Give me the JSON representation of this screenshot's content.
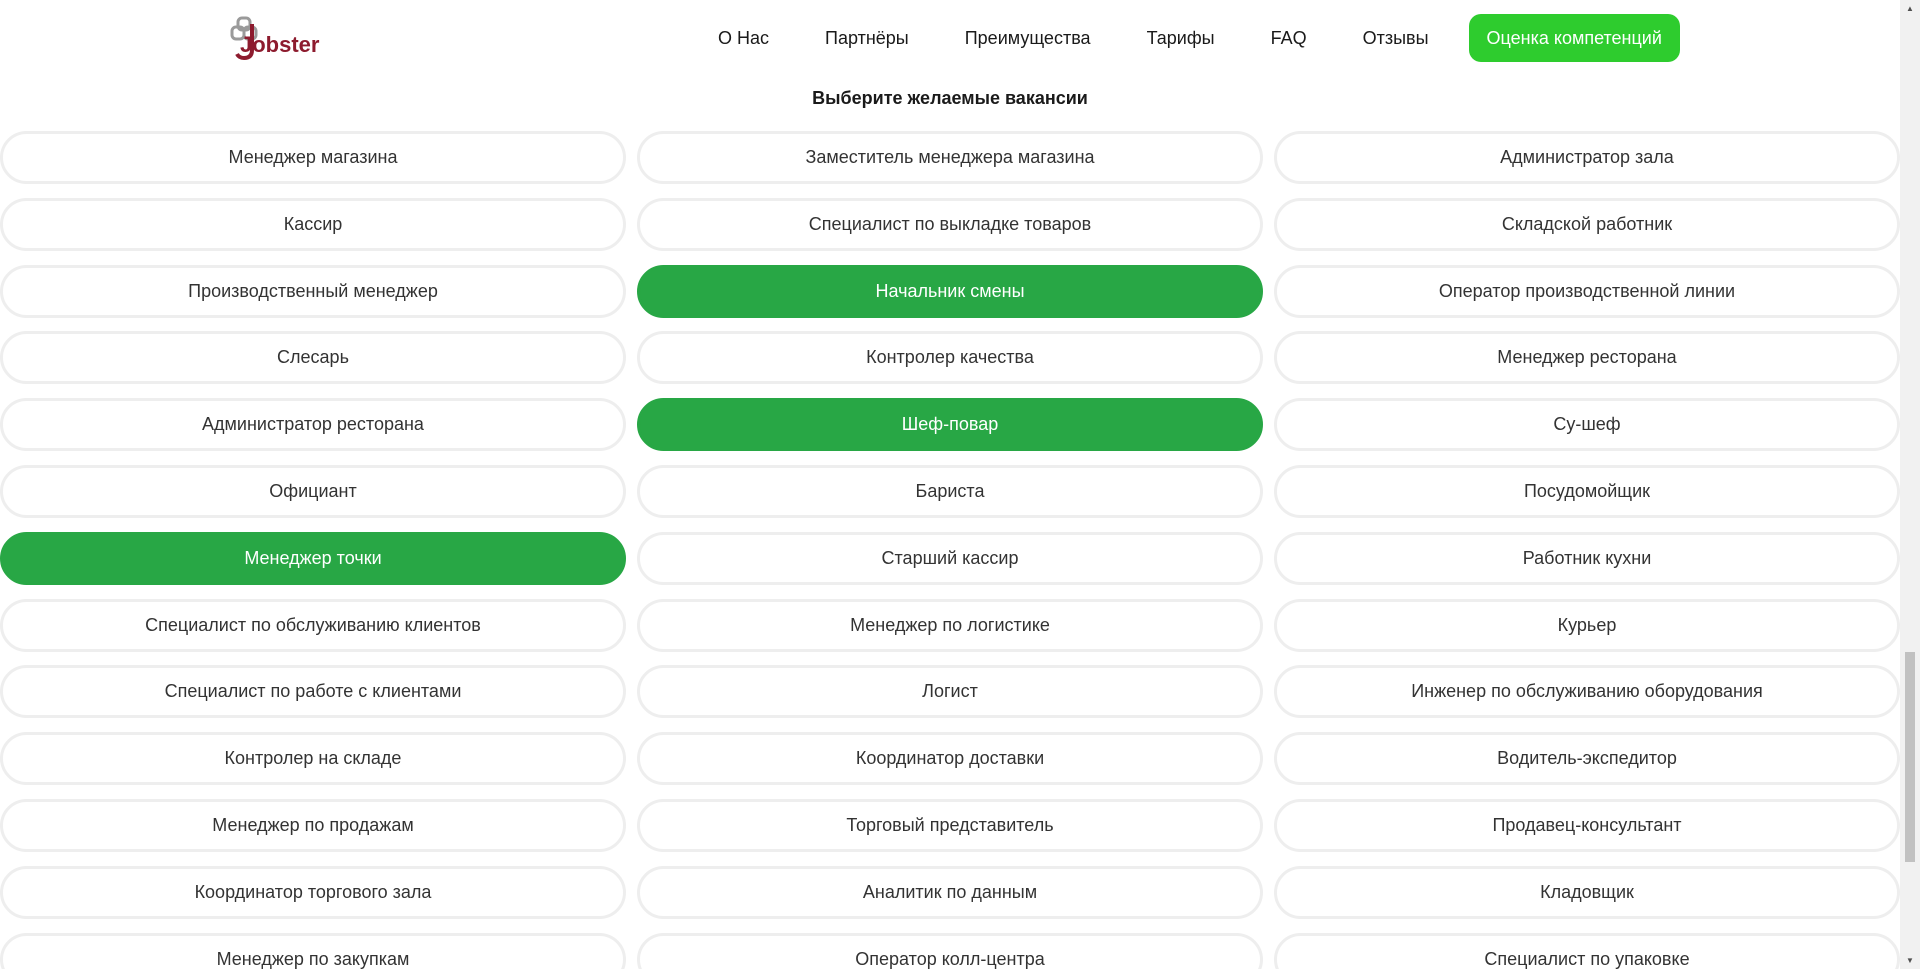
{
  "header": {
    "logo_text": "Jobster",
    "nav": [
      {
        "label": "О Нас"
      },
      {
        "label": "Партнёры"
      },
      {
        "label": "Преимущества"
      },
      {
        "label": "Тарифы"
      },
      {
        "label": "FAQ"
      },
      {
        "label": "Отзывы"
      }
    ],
    "cta_label": "Оценка компетенций"
  },
  "section": {
    "title": "Выберите желаемые вакансии"
  },
  "vacancies": [
    {
      "label": "Менеджер магазина",
      "selected": false
    },
    {
      "label": "Заместитель менеджера магазина",
      "selected": false
    },
    {
      "label": "Администратор зала",
      "selected": false
    },
    {
      "label": "Кассир",
      "selected": false
    },
    {
      "label": "Специалист по выкладке товаров",
      "selected": false
    },
    {
      "label": "Складской работник",
      "selected": false
    },
    {
      "label": "Производственный менеджер",
      "selected": false
    },
    {
      "label": "Начальник смены",
      "selected": true
    },
    {
      "label": "Оператор производственной линии",
      "selected": false
    },
    {
      "label": "Слесарь",
      "selected": false
    },
    {
      "label": "Контролер качества",
      "selected": false
    },
    {
      "label": "Менеджер ресторана",
      "selected": false
    },
    {
      "label": "Администратор ресторана",
      "selected": false
    },
    {
      "label": "Шеф-повар",
      "selected": true
    },
    {
      "label": "Су-шеф",
      "selected": false
    },
    {
      "label": "Официант",
      "selected": false
    },
    {
      "label": "Бариста",
      "selected": false
    },
    {
      "label": "Посудомойщик",
      "selected": false
    },
    {
      "label": "Менеджер точки",
      "selected": true
    },
    {
      "label": "Старший кассир",
      "selected": false
    },
    {
      "label": "Работник кухни",
      "selected": false
    },
    {
      "label": "Специалист по обслуживанию клиентов",
      "selected": false
    },
    {
      "label": "Менеджер по логистике",
      "selected": false
    },
    {
      "label": "Курьер",
      "selected": false
    },
    {
      "label": "Специалист по работе с клиентами",
      "selected": false
    },
    {
      "label": "Логист",
      "selected": false
    },
    {
      "label": "Инженер по обслуживанию оборудования",
      "selected": false
    },
    {
      "label": "Контролер на складе",
      "selected": false
    },
    {
      "label": "Координатор доставки",
      "selected": false
    },
    {
      "label": "Водитель-экспедитор",
      "selected": false
    },
    {
      "label": "Менеджер по продажам",
      "selected": false
    },
    {
      "label": "Торговый представитель",
      "selected": false
    },
    {
      "label": "Продавец-консультант",
      "selected": false
    },
    {
      "label": "Координатор торгового зала",
      "selected": false
    },
    {
      "label": "Аналитик по данным",
      "selected": false
    },
    {
      "label": "Кладовщик",
      "selected": false
    },
    {
      "label": "Менеджер по закупкам",
      "selected": false
    },
    {
      "label": "Оператор колл-центра",
      "selected": false
    },
    {
      "label": "Специалист по упаковке",
      "selected": false
    }
  ],
  "colors": {
    "brand": "#8d1b2e",
    "cta": "#2ecc2e",
    "selected": "#28a745",
    "pill_border": "#eeeeee"
  }
}
